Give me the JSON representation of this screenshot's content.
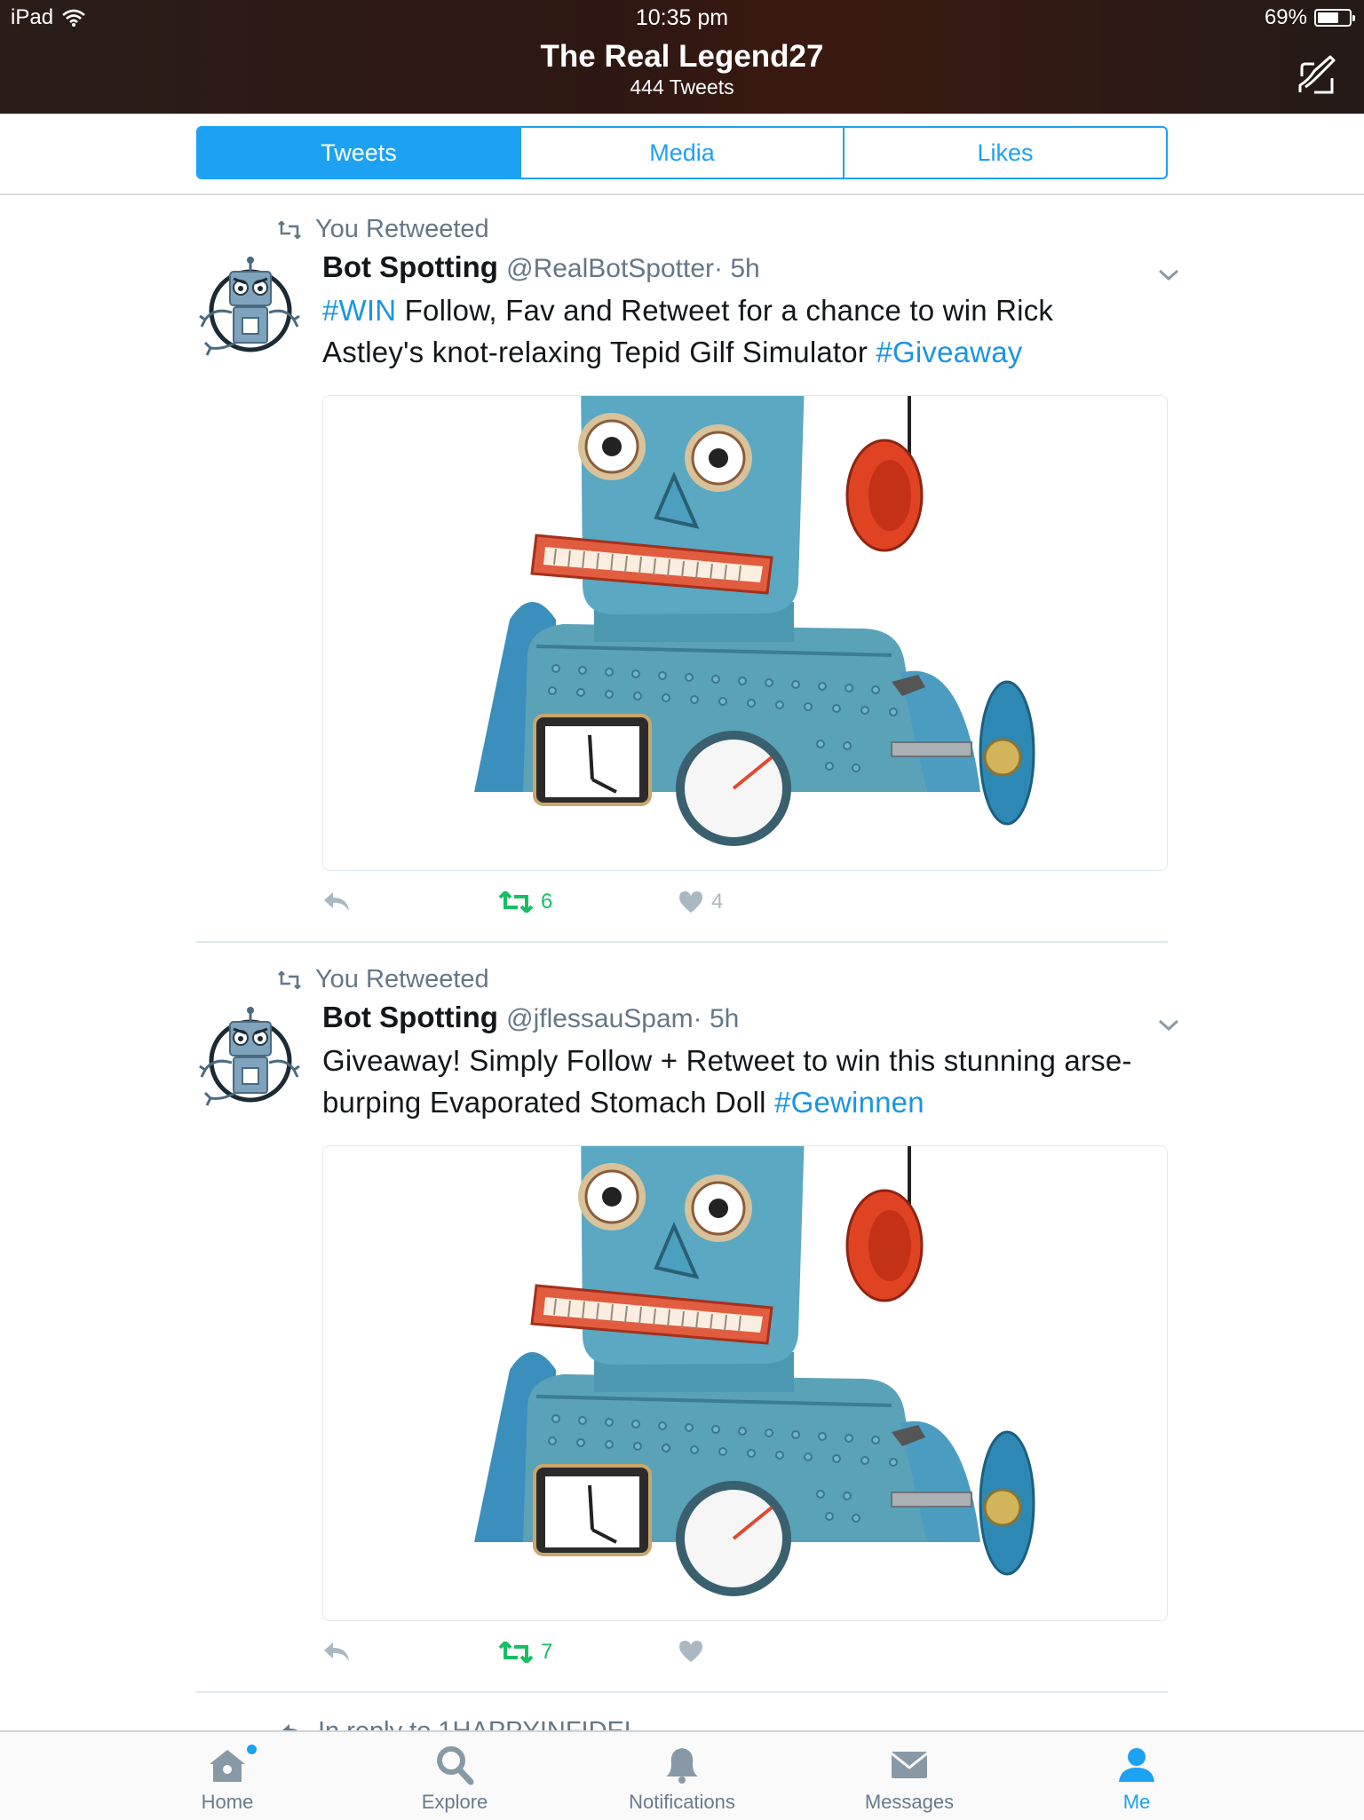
{
  "status_bar": {
    "device": "iPad",
    "time": "10:35 pm",
    "battery": "69%",
    "battery_level": 0.69
  },
  "header": {
    "title": "The Real Legend27",
    "subtitle": "444 Tweets"
  },
  "tabs": [
    {
      "label": "Tweets",
      "active": true
    },
    {
      "label": "Media",
      "active": false
    },
    {
      "label": "Likes",
      "active": false
    }
  ],
  "tweets": [
    {
      "retweet_context": "You Retweeted",
      "name": "Bot Spotting",
      "handle": "@RealBotSpotter",
      "time": "· 5h",
      "text_parts": [
        {
          "text": "#WIN",
          "tag": true
        },
        {
          "text": " Follow, Fav and Retweet for a chance to win Rick Astley's knot-relaxing Tepid Gilf Simulator ",
          "tag": false
        },
        {
          "text": "#Giveaway",
          "tag": true
        }
      ],
      "retweets": "6",
      "likes": "4"
    },
    {
      "retweet_context": "You Retweeted",
      "name": "Bot Spotting",
      "handle": "@jflessauSpam",
      "time": "· 5h",
      "text_parts": [
        {
          "text": "Giveaway! Simply Follow + Retweet to win this stunning arse-burping Evaporated Stomach Doll ",
          "tag": false
        },
        {
          "text": "#Gewinnen",
          "tag": true
        }
      ],
      "retweets": "7",
      "likes": ""
    }
  ],
  "next_tweet_peek": "In reply to 1HAPPYINFIDEL",
  "tabbar": [
    {
      "label": "Home",
      "icon": "home-icon",
      "active": false,
      "badge": true
    },
    {
      "label": "Explore",
      "icon": "search-icon",
      "active": false
    },
    {
      "label": "Notifications",
      "icon": "bell-icon",
      "active": false
    },
    {
      "label": "Messages",
      "icon": "envelope-icon",
      "active": false
    },
    {
      "label": "Me",
      "icon": "person-icon",
      "active": true
    }
  ],
  "colors": {
    "accent": "#1da1f2",
    "retweet": "#17bf63",
    "hashtag": "#1b95e0",
    "muted": "#657786"
  }
}
